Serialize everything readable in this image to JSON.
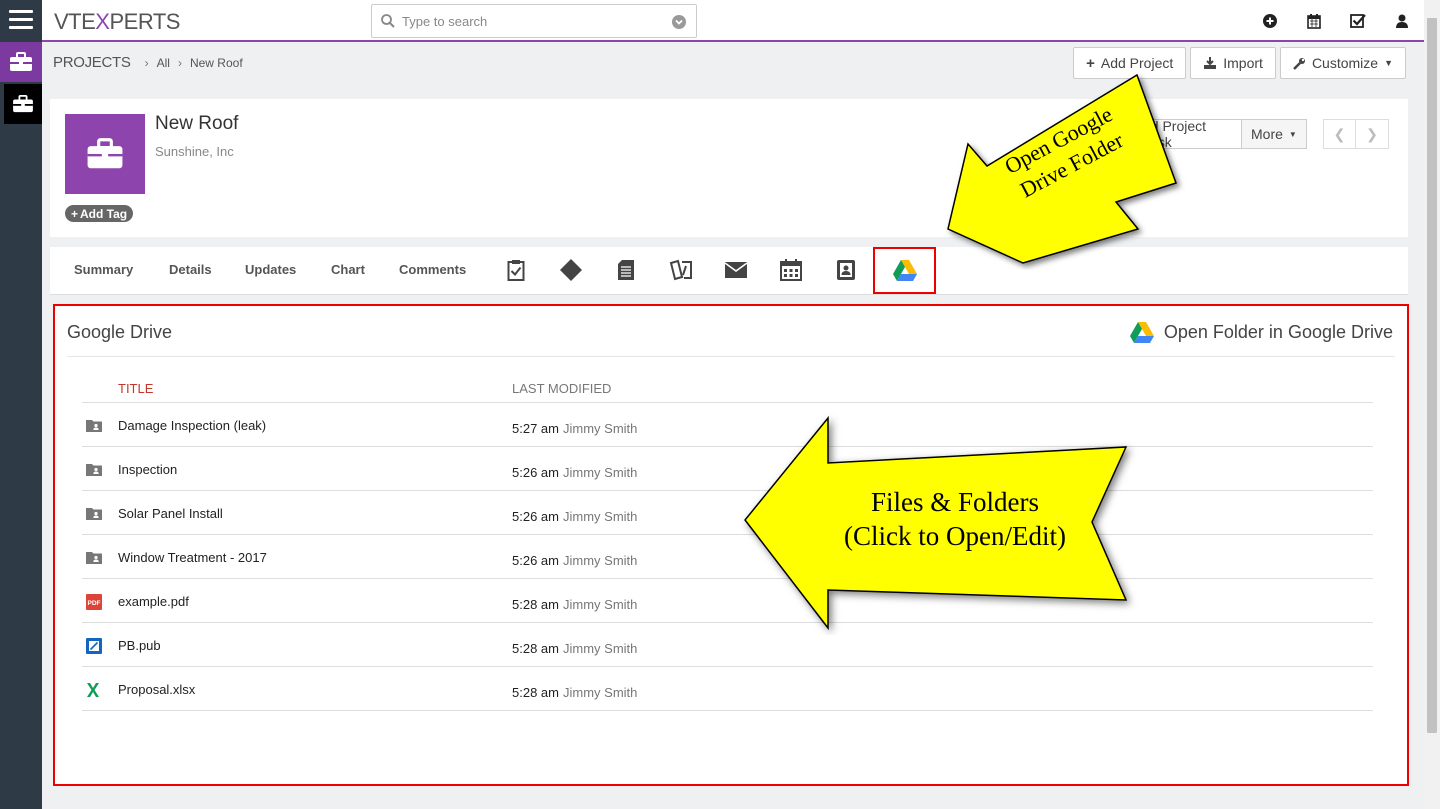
{
  "app": {
    "logo_pre": "VTE",
    "logo_x": "X",
    "logo_post": "PERTS"
  },
  "search": {
    "placeholder": "Type to search"
  },
  "breadcrumb": {
    "module": "PROJECTS",
    "filter": "All",
    "record": "New Roof"
  },
  "header_buttons": {
    "add_project": "Add Project",
    "import": "Import",
    "customize": "Customize"
  },
  "record": {
    "title": "New Roof",
    "account": "Sunshine, Inc",
    "add_tag": "Add Tag",
    "add_task": "dd Project Task",
    "more": "More"
  },
  "tabs": [
    "Summary",
    "Details",
    "Updates",
    "Chart",
    "Comments"
  ],
  "panel": {
    "title": "Google Drive",
    "open_folder": "Open Folder in Google Drive",
    "col_title": "TITLE",
    "col_modified": "LAST MODIFIED",
    "rows": [
      {
        "name": "Damage Inspection (leak)",
        "time": "5:27 am",
        "user": "Jimmy Smith",
        "type": "folder"
      },
      {
        "name": "Inspection",
        "time": "5:26 am",
        "user": "Jimmy Smith",
        "type": "folder"
      },
      {
        "name": "Solar Panel Install",
        "time": "5:26 am",
        "user": "Jimmy Smith",
        "type": "folder"
      },
      {
        "name": "Window Treatment - 2017",
        "time": "5:26 am",
        "user": "Jimmy Smith",
        "type": "folder"
      },
      {
        "name": "example.pdf",
        "time": "5:28 am",
        "user": "Jimmy Smith",
        "type": "pdf"
      },
      {
        "name": "PB.pub",
        "time": "5:28 am",
        "user": "Jimmy Smith",
        "type": "pub"
      },
      {
        "name": "Proposal.xlsx",
        "time": "5:28 am",
        "user": "Jimmy Smith",
        "type": "xlsx"
      }
    ]
  },
  "callouts": {
    "drive_line1": "Open Google",
    "drive_line2": "Drive Folder",
    "files_line1": "Files & Folders",
    "files_line2": "(Click to Open/Edit)"
  },
  "colors": {
    "brand": "#8e44ad",
    "sidebar": "#2f3a47",
    "highlight": "#ff0000",
    "callout": "#ffff00"
  }
}
